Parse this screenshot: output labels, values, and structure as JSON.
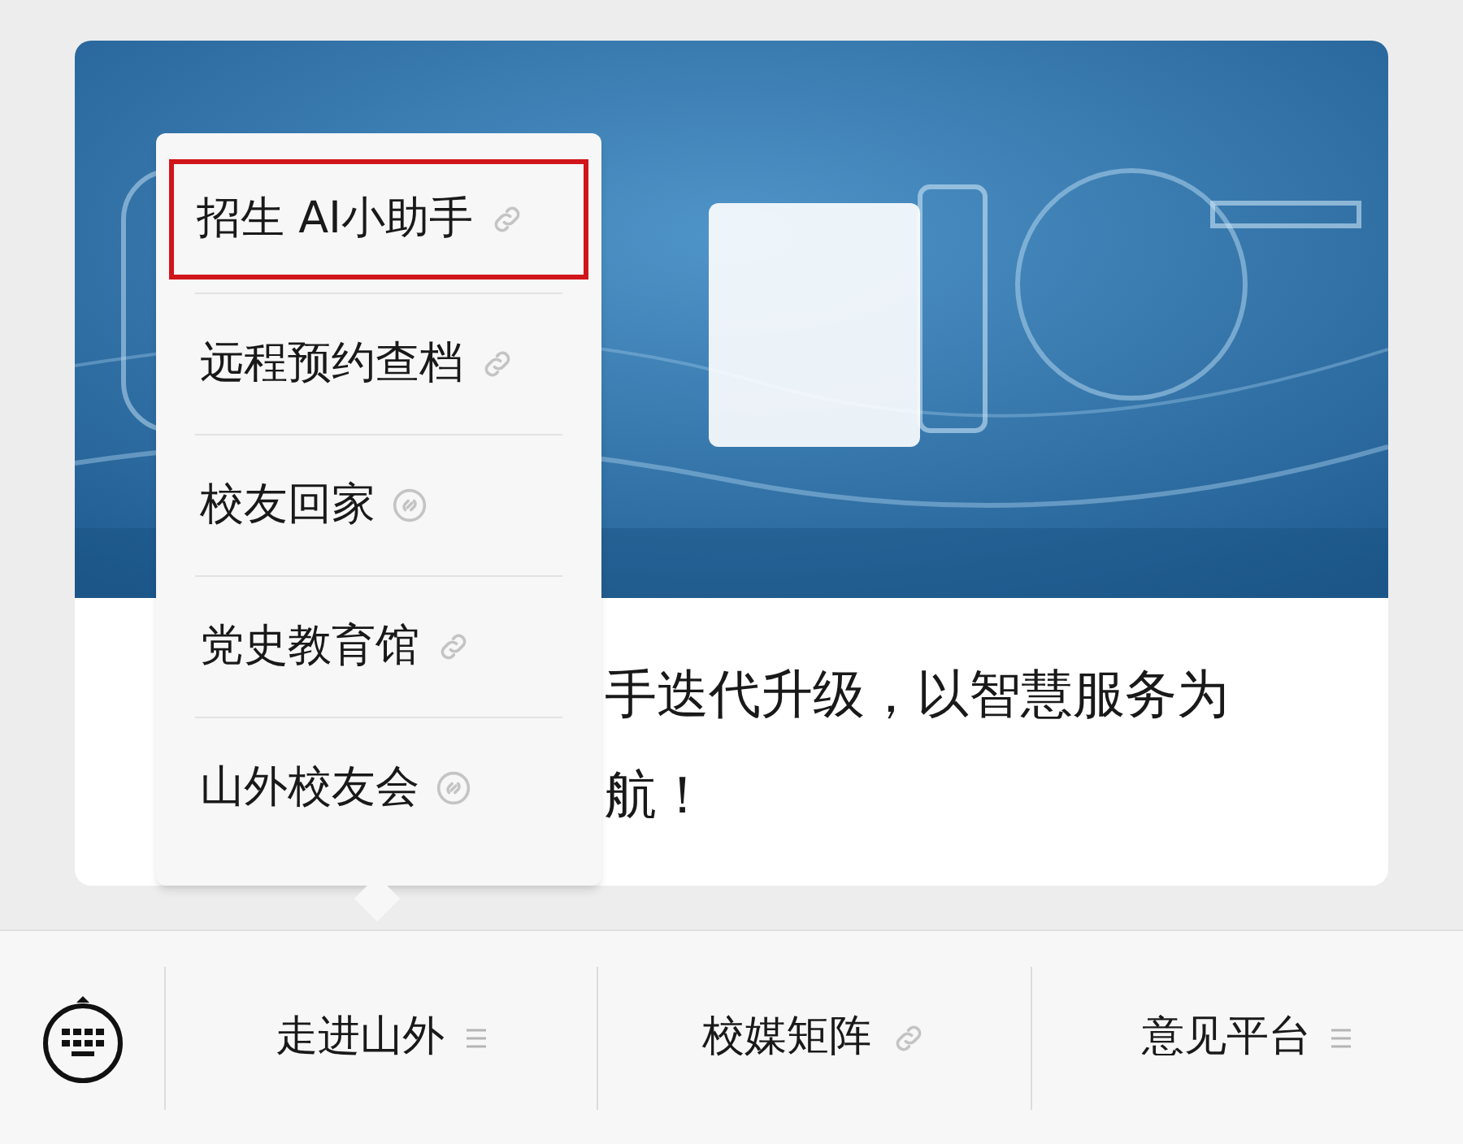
{
  "article": {
    "text_lines": [
      "手迭代升级，以智慧服务为",
      "航！"
    ]
  },
  "popup_menu": {
    "items": [
      {
        "label": "招生 AI小助手",
        "kind": "link",
        "selected": true
      },
      {
        "label": "远程预约查档",
        "kind": "link",
        "selected": false
      },
      {
        "label": "校友回家",
        "kind": "miniprogram",
        "selected": false
      },
      {
        "label": "党史教育馆",
        "kind": "link",
        "selected": false
      },
      {
        "label": "山外校友会",
        "kind": "miniprogram",
        "selected": false
      }
    ]
  },
  "bottom_menu": [
    {
      "label": "走进山外",
      "kind": "submenu"
    },
    {
      "label": "校媒矩阵",
      "kind": "link"
    },
    {
      "label": "意见平台",
      "kind": "submenu"
    }
  ]
}
